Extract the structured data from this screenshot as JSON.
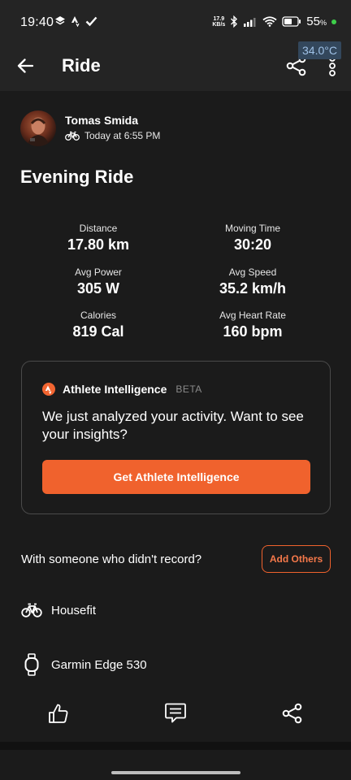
{
  "status_bar": {
    "time": "19:40",
    "net_speed_value": "17.9",
    "net_speed_unit": "KB/s",
    "battery_percent": "55",
    "battery_unit": "%",
    "icons": [
      "layers-icon",
      "strava-icon",
      "check-icon",
      "bluetooth-icon",
      "signal-icon",
      "wifi-icon",
      "battery-icon"
    ]
  },
  "header": {
    "title": "Ride",
    "back_icon": "arrow-left-icon",
    "share_icon": "share-icon",
    "more_icon": "more-vertical-icon",
    "temperature_overlay": "34.0°C"
  },
  "athlete": {
    "name": "Tomas Smida",
    "time": "Today at 6:55 PM",
    "activity_icon": "bike-icon"
  },
  "activity": {
    "title": "Evening Ride"
  },
  "stats": [
    {
      "label": "Distance",
      "value": "17.80 km"
    },
    {
      "label": "Moving Time",
      "value": "30:20"
    },
    {
      "label": "Avg Power",
      "value": "305 W"
    },
    {
      "label": "Avg Speed",
      "value": "35.2 km/h"
    },
    {
      "label": "Calories",
      "value": "819 Cal"
    },
    {
      "label": "Avg Heart Rate",
      "value": "160 bpm"
    }
  ],
  "athlete_intelligence": {
    "title": "Athlete Intelligence",
    "badge": "BETA",
    "text": "We just analyzed your activity. Want to see your insights?",
    "button": "Get Athlete Intelligence"
  },
  "others": {
    "prompt": "With someone who didn't record?",
    "button": "Add Others"
  },
  "gear": {
    "bike": "Housefit",
    "device": "Garmin Edge 530"
  },
  "actions": {
    "like_icon": "thumbs-up-icon",
    "comment_icon": "comment-icon",
    "share_icon": "share-icon"
  },
  "colors": {
    "accent": "#f0622d",
    "background": "#1b1b1b",
    "header": "#242424"
  }
}
